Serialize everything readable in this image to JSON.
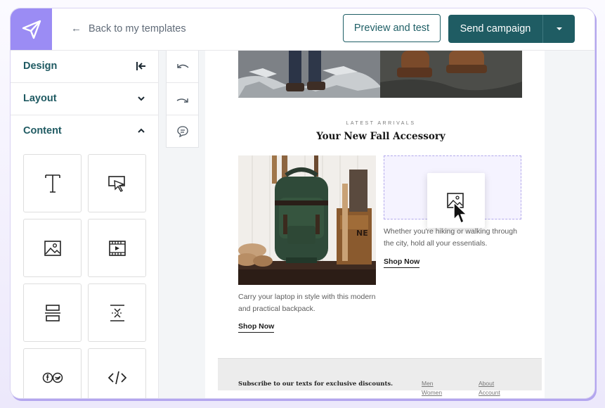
{
  "colors": {
    "brand": "#9b8cf4",
    "primary": "#1f5c63",
    "sidebar_label": "#1f5a62",
    "drop_zone": "#b3a9ec"
  },
  "header": {
    "logo_icon": "paper-plane-icon",
    "back_label": "Back to my templates",
    "preview_label": "Preview and test",
    "send_label": "Send campaign"
  },
  "sidebar": {
    "sections": [
      {
        "label": "Design",
        "icon": "collapse-left-icon"
      },
      {
        "label": "Layout",
        "icon": "chevron-down-icon"
      },
      {
        "label": "Content",
        "icon": "chevron-up-icon"
      }
    ],
    "blocks": [
      "text-block-icon",
      "button-block-icon",
      "image-block-icon",
      "video-block-icon",
      "divider-block-icon",
      "spacer-block-icon",
      "social-block-icon",
      "html-block-icon"
    ]
  },
  "tools": [
    "undo-icon",
    "redo-icon",
    "comment-icon"
  ],
  "email": {
    "eyebrow": "LATEST ARRIVALS",
    "title": "Your New Fall Accessory",
    "left_copy_1": "Carry your laptop in style with this modern",
    "left_copy_2": "and practical backpack.",
    "left_cta": "Shop Now",
    "right_copy_1": "Whether you're hiking or walking through",
    "right_copy_2": "the city, hold all your essentials.",
    "right_cta": "Shop Now",
    "footer_subscribe": "Subscribe to our texts for exclusive discounts.",
    "footer_links": [
      "Men",
      "Women",
      "About",
      "Account"
    ]
  }
}
